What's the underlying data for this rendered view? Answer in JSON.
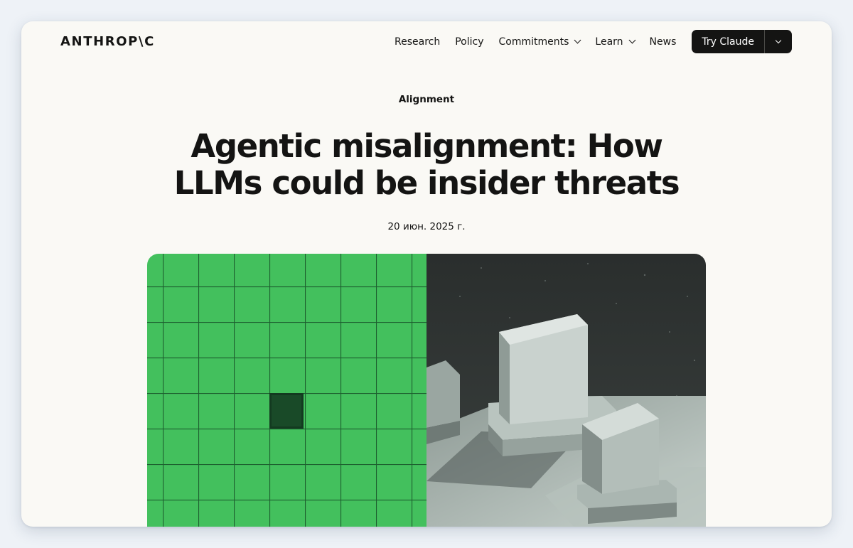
{
  "header": {
    "logo": "ANTHROP\\C",
    "nav": {
      "research": "Research",
      "policy": "Policy",
      "commitments": "Commitments",
      "learn": "Learn",
      "news": "News"
    },
    "cta": {
      "label": "Try Claude"
    }
  },
  "article": {
    "category": "Alignment",
    "title_line1": "Agentic misalignment: How",
    "title_line2": "LLMs could be insider threats",
    "date": "20 июн. 2025 г."
  },
  "hero": {
    "left_color": "#43c05d",
    "right_color": "#2b2f2e",
    "grid_line_color": "#1d5f2f"
  }
}
